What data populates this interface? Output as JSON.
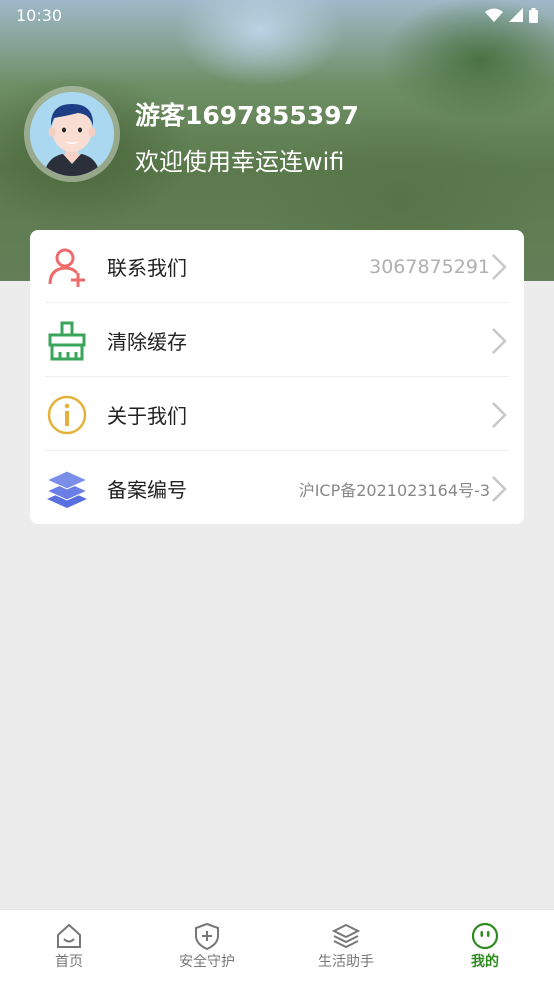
{
  "status_bar": {
    "time": "10:30"
  },
  "profile": {
    "username": "游客1697855397",
    "welcome": "欢迎使用幸运连wifi"
  },
  "menu": [
    {
      "icon": "add-user-icon",
      "label": "联系我们",
      "value": "3067875291"
    },
    {
      "icon": "broom-icon",
      "label": "清除缓存",
      "value": ""
    },
    {
      "icon": "info-icon",
      "label": "关于我们",
      "value": ""
    },
    {
      "icon": "layers-icon",
      "label": "备案编号",
      "value": "沪ICP备2021023164号-3"
    }
  ],
  "tabs": [
    {
      "icon": "home-icon",
      "label": "首页",
      "active": false
    },
    {
      "icon": "shield-plus-icon",
      "label": "安全守护",
      "active": false
    },
    {
      "icon": "layers-icon",
      "label": "生活助手",
      "active": false
    },
    {
      "icon": "smile-face-icon",
      "label": "我的",
      "active": true
    }
  ],
  "colors": {
    "active_tab": "#2e8b20",
    "contact_icon": "#ef6b6b",
    "clear_icon": "#3aa55a",
    "info_icon": "#e4b23a",
    "record_icon": "#5a6fe0"
  }
}
